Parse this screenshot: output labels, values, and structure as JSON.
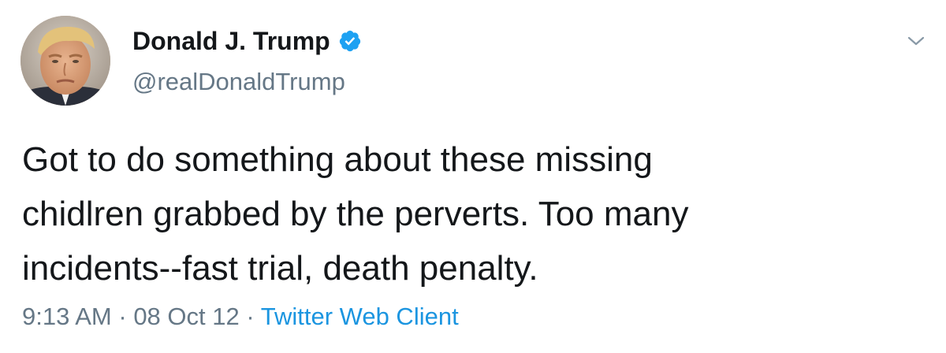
{
  "tweet": {
    "display_name": "Donald J. Trump",
    "handle": "@realDonaldTrump",
    "verified_icon": "verified-badge-icon",
    "menu_icon": "chevron-down-icon",
    "text": "Got to do something about these missing\nchidlren grabbed by the perverts. Too many\nincidents--fast trial, death penalty.",
    "time": "9:13 AM",
    "separator": " · ",
    "date": "08 Oct 12",
    "source": "Twitter Web Client"
  },
  "colors": {
    "text_primary": "#14171a",
    "text_secondary": "#657786",
    "link": "#1b95e0",
    "verified": "#1da1f2"
  }
}
